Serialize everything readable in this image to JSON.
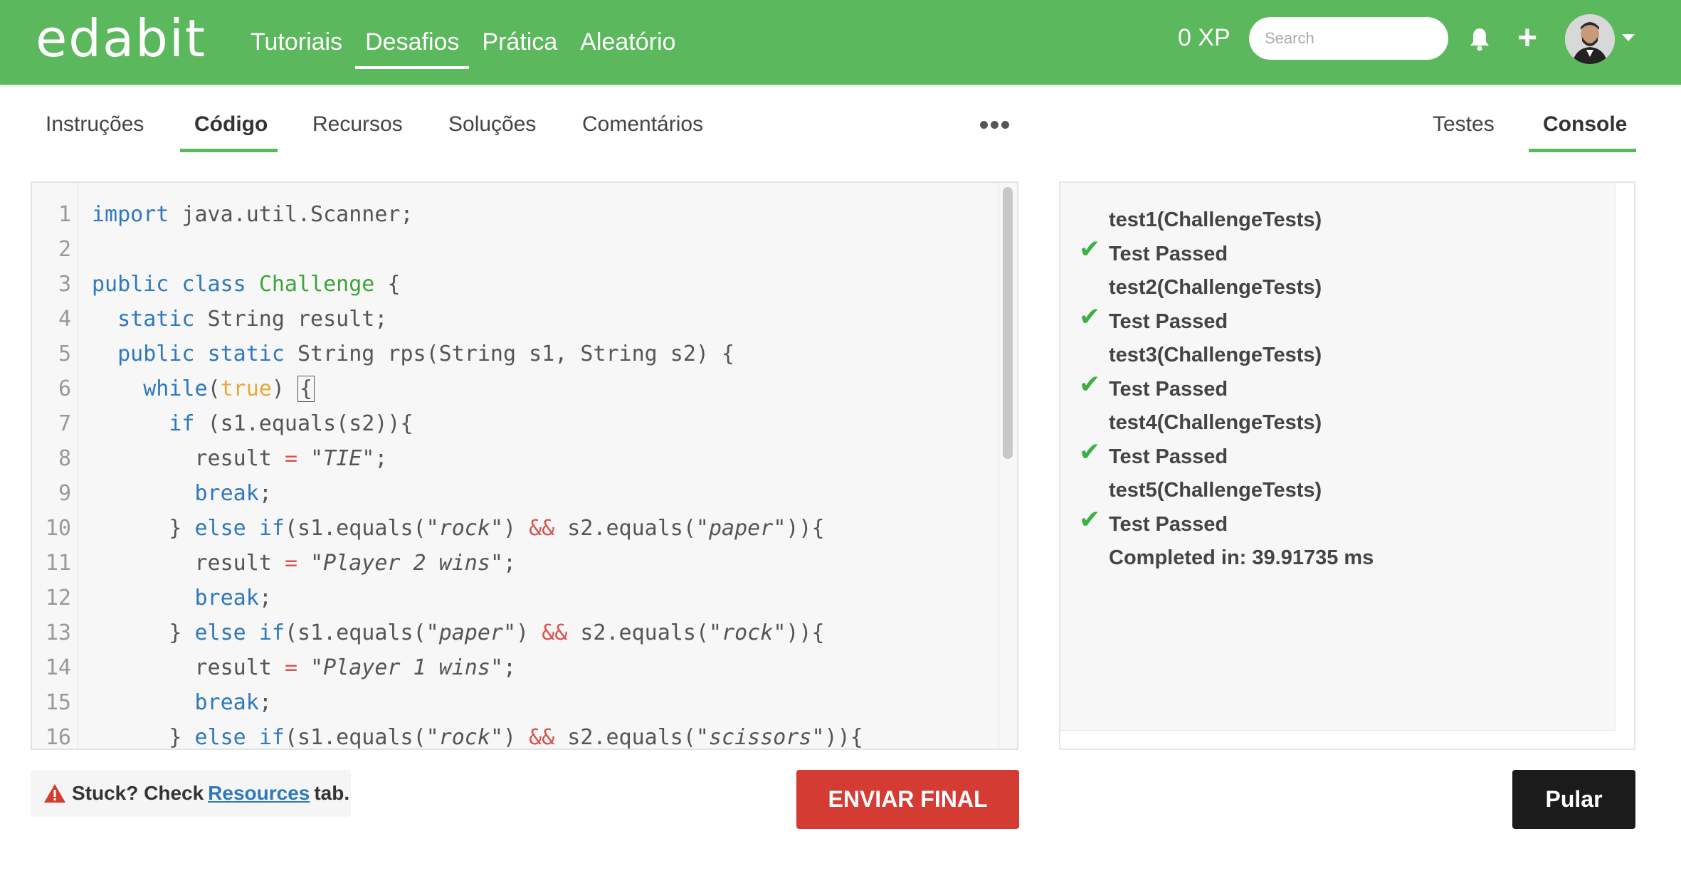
{
  "header": {
    "logo": "edabit",
    "nav": [
      "Tutoriais",
      "Desafios",
      "Prática",
      "Aleatório"
    ],
    "active_nav": "Desafios",
    "xp": "0 XP",
    "search_placeholder": "Search",
    "icons": [
      "bell-icon",
      "plus-icon",
      "avatar",
      "chevron-down-icon"
    ]
  },
  "tabs": {
    "left": [
      "Instruções",
      "Código",
      "Recursos",
      "Soluções",
      "Comentários"
    ],
    "active_left": "Código",
    "right": [
      "Testes",
      "Console"
    ],
    "active_right": "Console"
  },
  "editor": {
    "lines": [
      "import java.util.Scanner;",
      "",
      "public class Challenge {",
      "  static String result;",
      "  public static String rps(String s1, String s2) {",
      "    while(true) {",
      "      if (s1.equals(s2)){",
      "        result = \"TIE\";",
      "        break;",
      "      } else if(s1.equals(\"rock\") && s2.equals(\"paper\")){",
      "        result = \"Player 2 wins\";",
      "        break;",
      "      } else if(s1.equals(\"paper\") && s2.equals(\"rock\")){",
      "        result = \"Player 1 wins\";",
      "        break;",
      "      } else if(s1.equals(\"rock\") && s2.equals(\"scissors\")){"
    ],
    "line_numbers": [
      "1",
      "2",
      "3",
      "4",
      "5",
      "6",
      "7",
      "8",
      "9",
      "10",
      "11",
      "12",
      "13",
      "14",
      "15",
      "16"
    ]
  },
  "console": {
    "tests": [
      {
        "name": "test1(ChallengeTests)",
        "result": "Test Passed"
      },
      {
        "name": "test2(ChallengeTests)",
        "result": "Test Passed"
      },
      {
        "name": "test3(ChallengeTests)",
        "result": "Test Passed"
      },
      {
        "name": "test4(ChallengeTests)",
        "result": "Test Passed"
      },
      {
        "name": "test5(ChallengeTests)",
        "result": "Test Passed"
      }
    ],
    "completed": "Completed in: 39.91735 ms",
    "check_glyph": "✔"
  },
  "footer": {
    "stuck_prefix": "Stuck? Check",
    "stuck_link": "Resources",
    "stuck_suffix": "tab.",
    "submit_label": "ENVIAR FINAL",
    "skip_label": "Pular"
  },
  "colors": {
    "brand_green": "#5cb85c",
    "submit_red": "#d43c33",
    "skip_black": "#1b1b1b",
    "keyword_blue": "#2f78bd",
    "class_green": "#3aa53a",
    "literal_yellow": "#e8a93a",
    "operator_red": "#d9534f",
    "check_green": "#3cb043"
  }
}
